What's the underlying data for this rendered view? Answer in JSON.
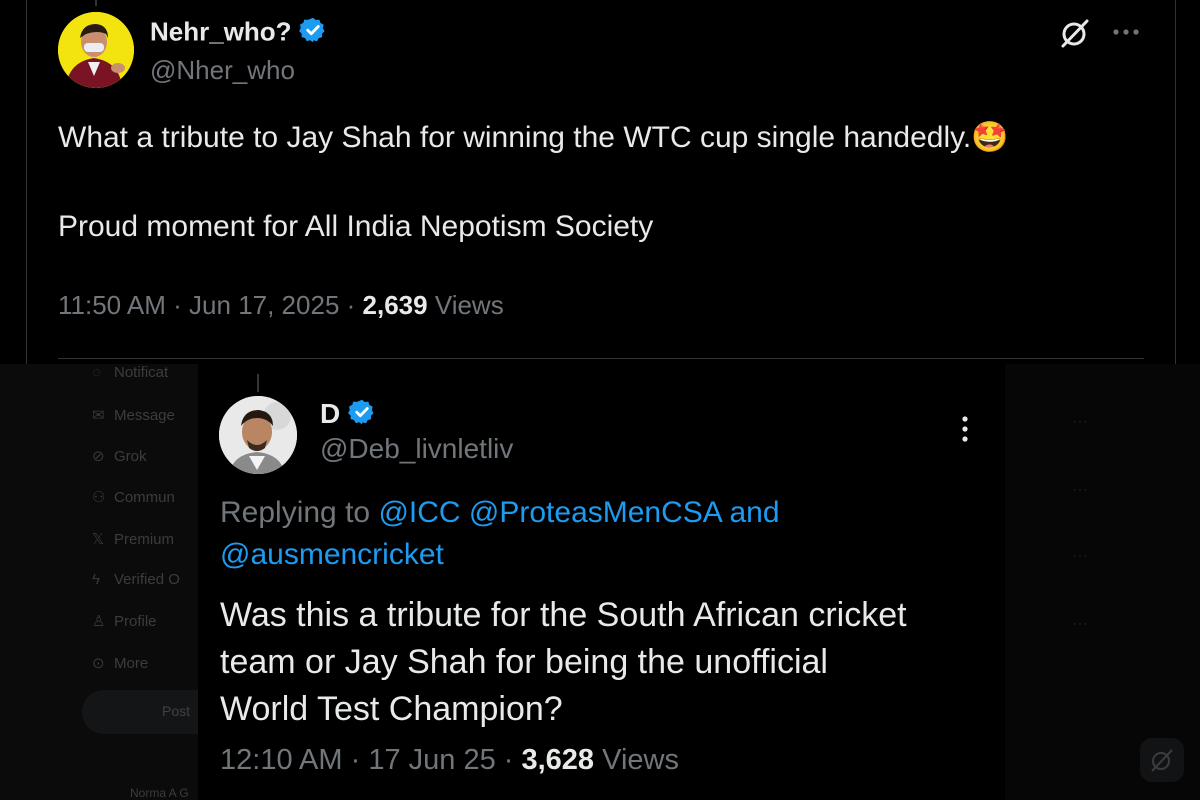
{
  "tweet": {
    "display_name": "Nehr_who?",
    "handle": "@Nher_who",
    "text_line1": "What a tribute to Jay Shah for winning the WTC cup single handedly.",
    "emoji": "🤩",
    "text_line2": "Proud moment for All India Nepotism Society",
    "time": "11:50 AM",
    "sep": " · ",
    "date": "Jun 17, 2025",
    "views_count": "2,639",
    "views_label": " Views",
    "icons": [
      "verified-badge-icon",
      "grok-icon",
      "more-icon"
    ]
  },
  "reply": {
    "display_name": "D",
    "handle": "@Deb_livnletliv",
    "replying_prefix": "Replying to ",
    "mention_1": "@ICC",
    "mention_2": "@ProteasMenCSA",
    "mention_and": "and",
    "mention_3": "@ausmencricket",
    "text": "Was this a tribute for the South African cricket team or Jay Shah for being the unofficial World Test Champion?",
    "time": "12:10 AM",
    "sep": " · ",
    "date": "17 Jun 25",
    "views_count": "3,628",
    "views_label": " Views",
    "icons": [
      "verified-badge-icon",
      "more-vertical-icon"
    ]
  },
  "background": {
    "sidebar_items": [
      "Notificat",
      "Message",
      "Grok",
      "Commun",
      "Premium",
      "Verified O",
      "Profile",
      "More"
    ],
    "post_button": "Post",
    "account_name": "Norma A G"
  },
  "colors": {
    "background": "#000000",
    "text": "#e7e9ea",
    "muted": "#71767b",
    "link": "#1d9bf0",
    "divider": "#2f3336"
  }
}
